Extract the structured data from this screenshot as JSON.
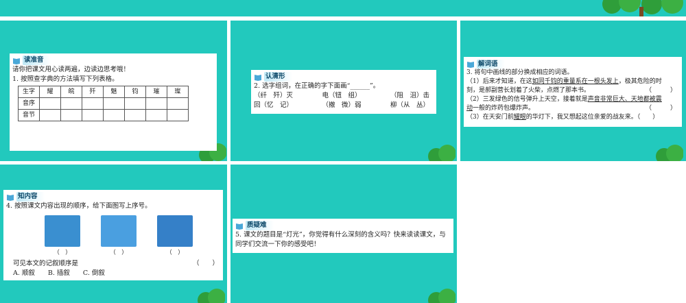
{
  "slide1": {
    "heading": "读准音",
    "intro": "请你把课文用心读两遍，边读边思考哦！",
    "q1": "1. 按照查字典的方法填写下列表格。",
    "table": {
      "header": [
        "生字",
        "耀",
        "皖",
        "歼",
        "魅",
        "钧",
        "璀",
        "璨"
      ],
      "rows": [
        [
          "音序",
          "",
          "",
          "",
          "",
          "",
          "",
          ""
        ],
        [
          "音节",
          "",
          "",
          "",
          "",
          "",
          "",
          ""
        ]
      ]
    }
  },
  "slide2": {
    "heading": "认清形",
    "q2": "2. 选字组词，在正确的字下面画“______”。",
    "row1": [
      "（纤　歼）灭",
      "电（钮　组）",
      "（阻　沮）击"
    ],
    "row2": [
      "回（忆　记）",
      "（撤　微）弱",
      "柳（从　丛）"
    ]
  },
  "slide3": {
    "heading": "解词语",
    "q3": "3. 将句中画线的部分换成相应的词语。",
    "items": [
      {
        "pre": "（1）后来才知道，在这",
        "u": "如同千钧的重量系在一根头发上",
        "post": "，极其危险的时",
        "cont": "刻，是郝副营长划着了火柴，点燃了那本书。",
        "ans": "（　　　）"
      },
      {
        "pre": "（2）三发绿色的信号弹升上天空，接着就是",
        "u": "声音非常巨大、天地都被震",
        "cont_u": "动",
        "cont": "一般的炸药包爆炸声。",
        "ans": "（　　　）"
      },
      {
        "pre": "（3）在天安门前",
        "u": "耀眼",
        "post": "的华灯下，我又想起这位亲爱的战友来。",
        "ans": "（　　）"
      }
    ]
  },
  "slide4": {
    "heading": "知内容",
    "q4": "4. 按照课文内容出现的顺序，给下面图写上序号。",
    "paren": [
      "（　）",
      "（　）",
      "（　）"
    ],
    "q4b": "可见本文的记叙顺序是",
    "ans": "（　　）",
    "options": "A. 顺叙　　B. 插叙　　C. 倒叙"
  },
  "slide5": {
    "heading": "质疑难",
    "q5a": "5. 课文的题目是“灯光”，你觉得有什么深刻的含义吗？快来读读课文，与",
    "q5b": "同学们交流一下你的感受吧！"
  }
}
